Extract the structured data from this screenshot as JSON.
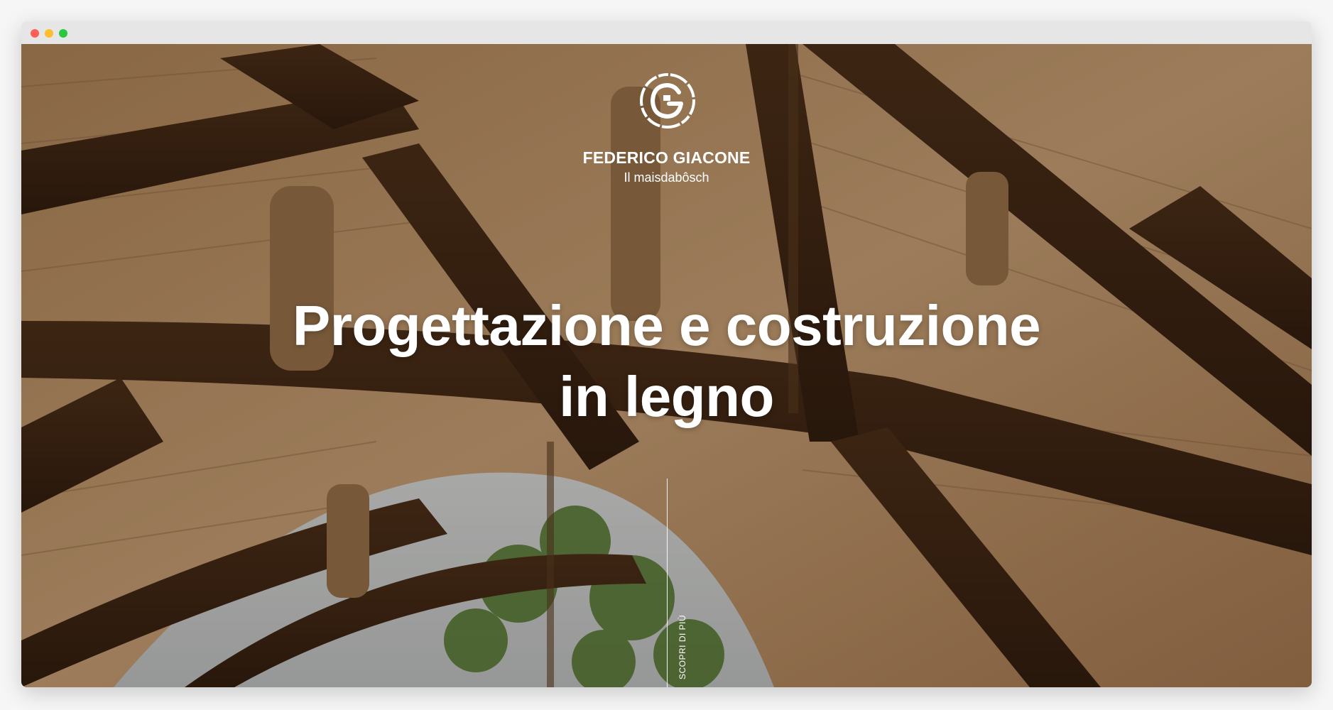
{
  "brand": {
    "name": "FEDERICO GIACONE",
    "tagline": "Il maisdabôsch",
    "logo_letter": "G"
  },
  "hero": {
    "headline_line1": "Progettazione e costruzione",
    "headline_line2": "in legno",
    "scroll_label": "SCOPRI DI PIÙ"
  },
  "colors": {
    "text": "#ffffff",
    "beam": "#3a2314",
    "plank": "#c9a27a"
  }
}
